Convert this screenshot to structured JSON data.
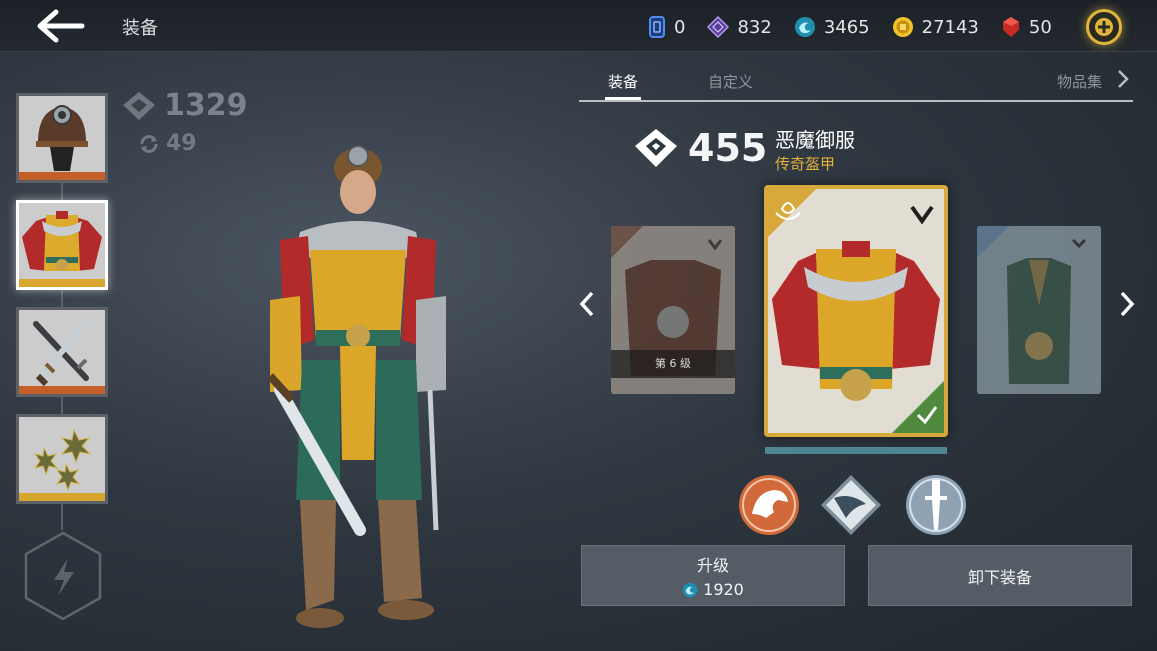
{
  "header": {
    "title": "装备",
    "currencies": [
      {
        "name": "cards",
        "value": "0",
        "color": "#3d7be0"
      },
      {
        "name": "gems-purple",
        "value": "832",
        "color": "#9a7ad8"
      },
      {
        "name": "orbs",
        "value": "3465",
        "color": "#25a7c8"
      },
      {
        "name": "coins",
        "value": "27143",
        "color": "#f0c22a"
      },
      {
        "name": "rubies",
        "value": "50",
        "color": "#e03a30"
      }
    ]
  },
  "left_panel": {
    "total_power": "1329",
    "sub_value": "49",
    "slots": [
      {
        "name": "helmet",
        "bar_color": "#c45f2a"
      },
      {
        "name": "armor",
        "bar_color": "#d8a52e"
      },
      {
        "name": "weapons",
        "bar_color": "#c45f2a"
      },
      {
        "name": "shuriken",
        "bar_color": "#d8a52e"
      }
    ]
  },
  "tabs": {
    "equip": "装备",
    "customize": "自定义",
    "collection": "物品集"
  },
  "item": {
    "power": "455",
    "name": "恶魔御服",
    "rarity": "传奇盔甲",
    "left_card_level": "第 6 级"
  },
  "buttons": {
    "upgrade_label": "升级",
    "upgrade_cost": "1920",
    "unequip_label": "卸下装备"
  },
  "colors": {
    "legendary": "#d7a93a",
    "rarity_text": "#e4b13c",
    "equipped_check": "#4f8a3e"
  }
}
